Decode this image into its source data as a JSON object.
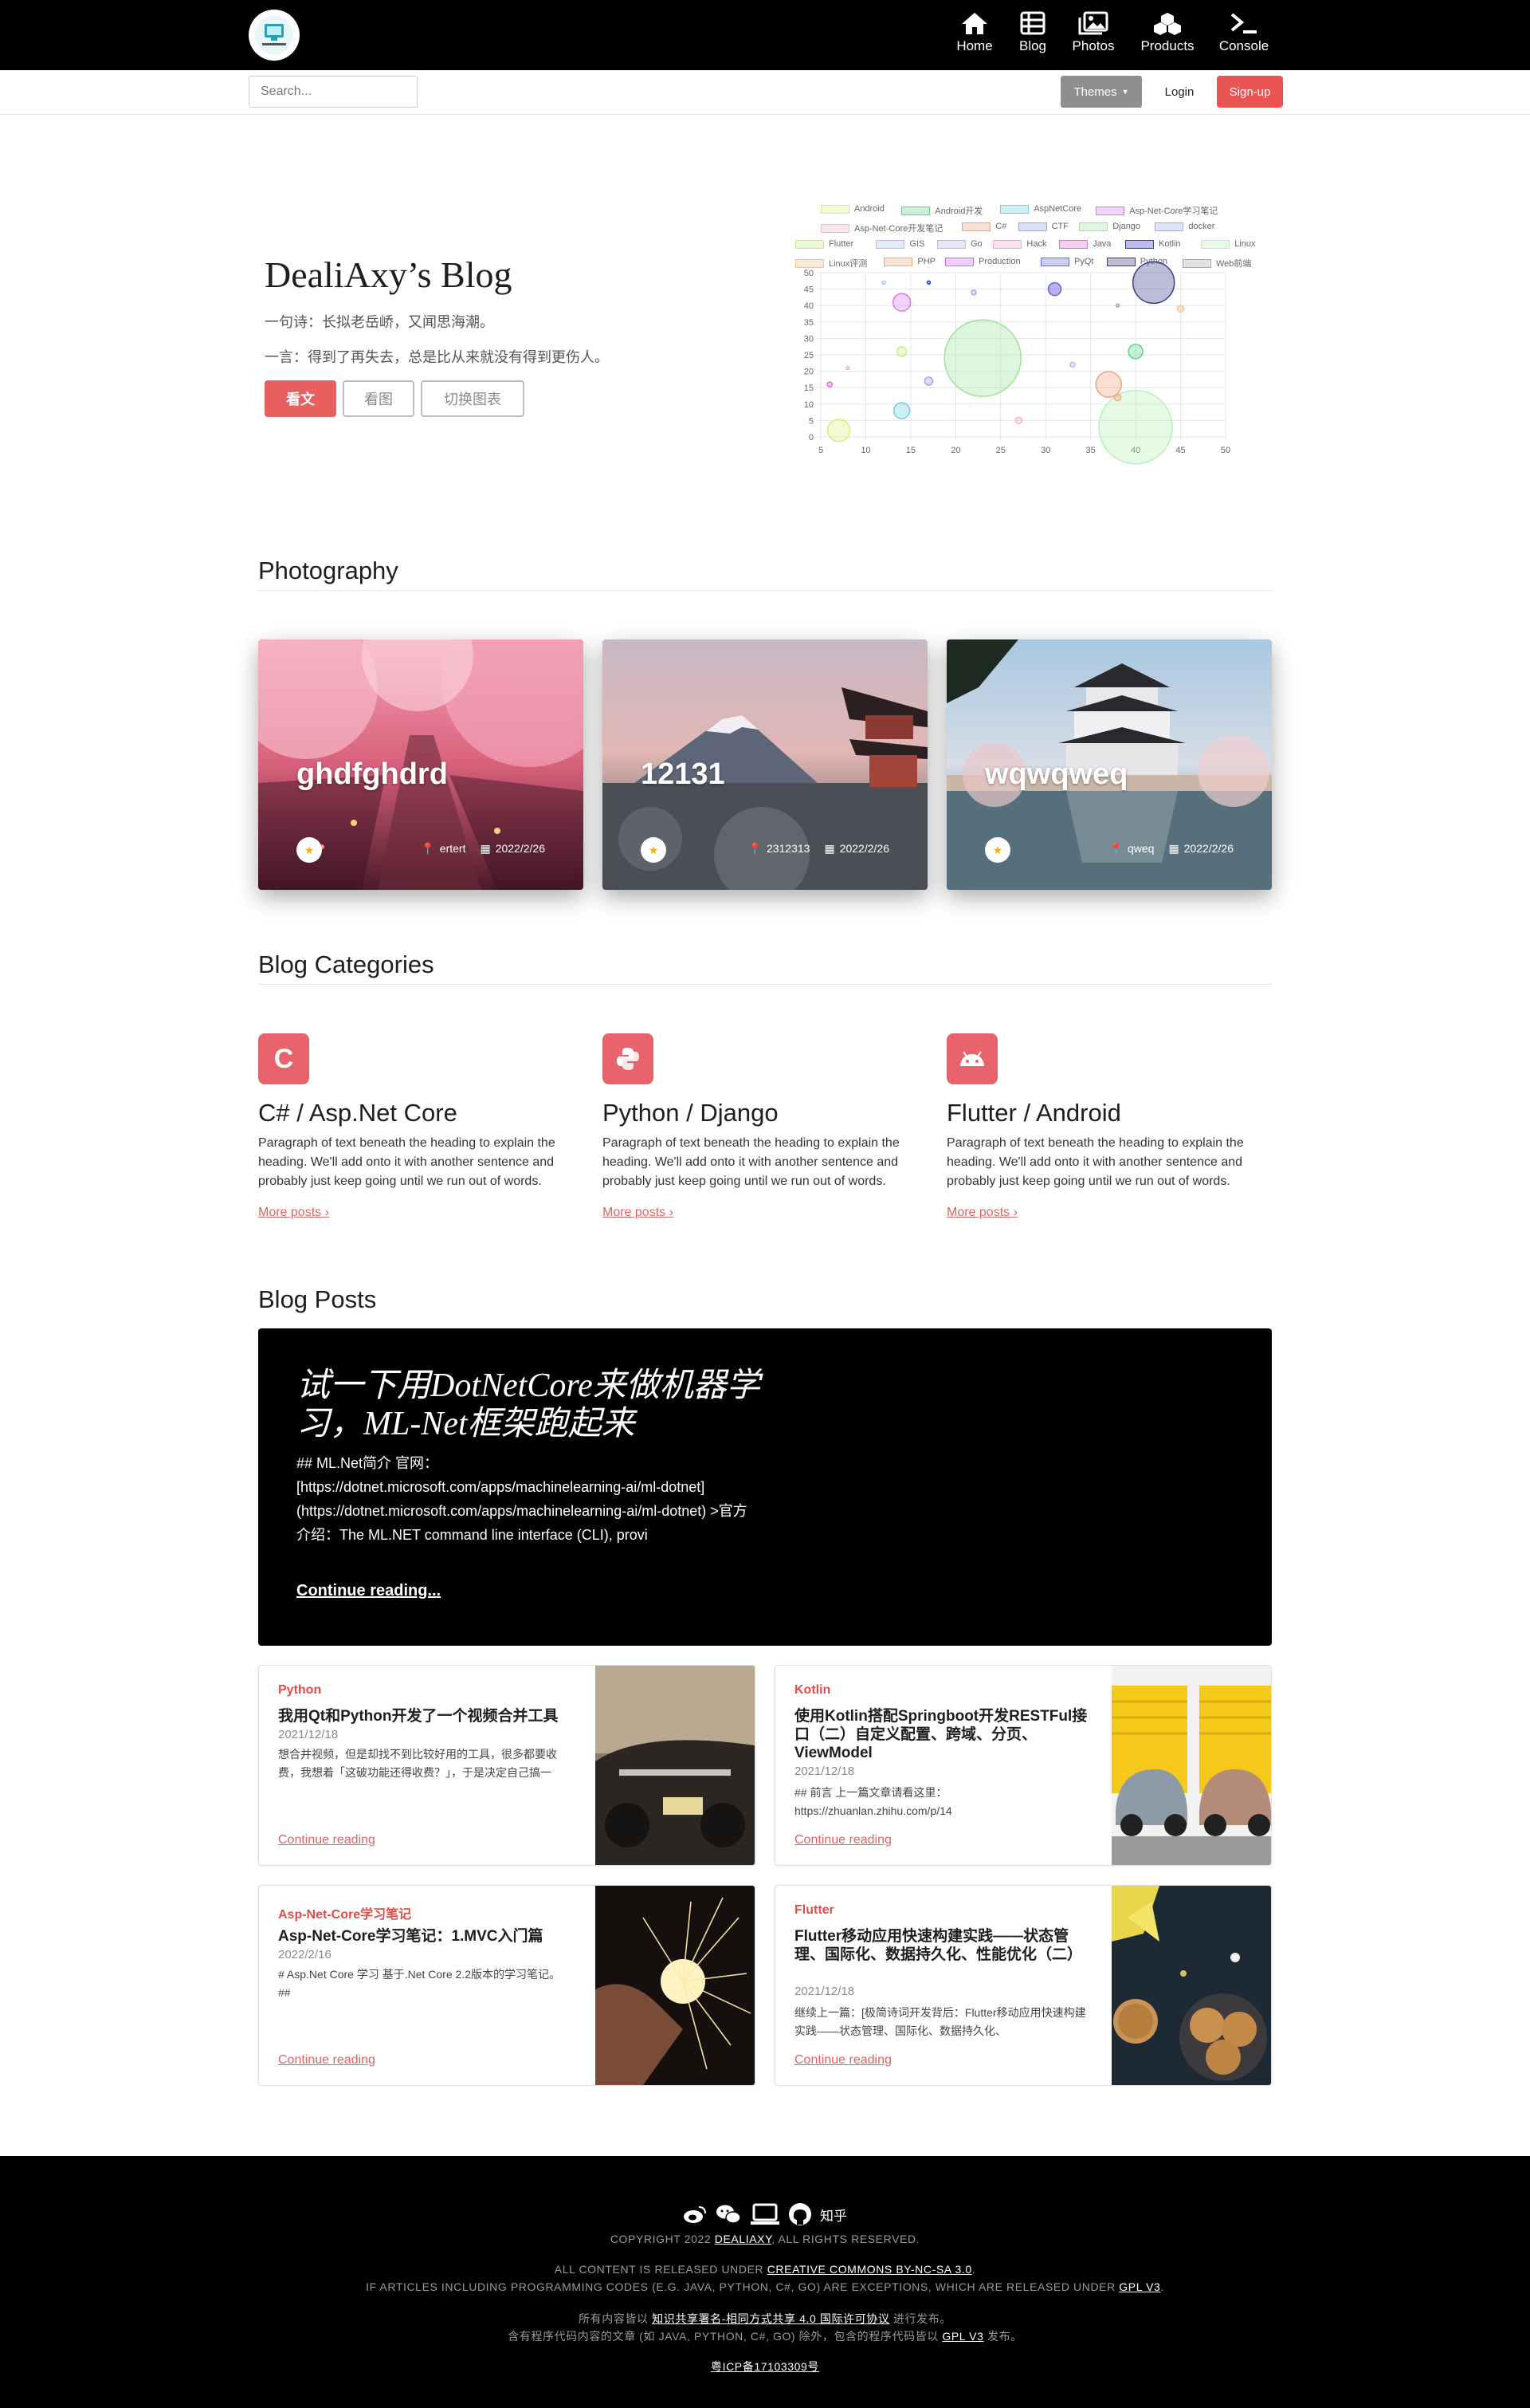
{
  "nav": {
    "items": [
      {
        "label": "Home",
        "icon": "home-icon"
      },
      {
        "label": "Blog",
        "icon": "blog-icon"
      },
      {
        "label": "Photos",
        "icon": "photos-icon"
      },
      {
        "label": "Products",
        "icon": "products-icon"
      },
      {
        "label": "Console",
        "icon": "console-icon"
      }
    ]
  },
  "subbar": {
    "search_placeholder": "Search...",
    "themes_label": "Themes",
    "login_label": "Login",
    "signup_label": "Sign-up"
  },
  "hero": {
    "title": "DealiAxy’s Blog",
    "line1": "一句诗：长拟老岳峤，又闻思海潮。",
    "line2": "一言：得到了再失去，总是比从来就没有得到更伤人。",
    "btn_read": "看文",
    "btn_photo": "看图",
    "btn_switch": "切换图表"
  },
  "chart_data": {
    "type": "scatter",
    "subtype": "bubble",
    "xlim": [
      5,
      50
    ],
    "ylim": [
      0,
      50
    ],
    "xticks": [
      "5",
      "10",
      "15",
      "20",
      "25",
      "30",
      "35",
      "40",
      "45",
      "50"
    ],
    "yticks": [
      "0",
      "5",
      "10",
      "15",
      "20",
      "25",
      "30",
      "35",
      "40",
      "45",
      "50"
    ],
    "legend_position": "top",
    "series": [
      {
        "name": "Android",
        "color": "#d5ef7f",
        "x": 7,
        "y": 2,
        "r": 14
      },
      {
        "name": "Android开发",
        "color": "#5ed486",
        "x": 40,
        "y": 26,
        "r": 9
      },
      {
        "name": "AspNetCore",
        "color": "#6fd0e8",
        "x": 14,
        "y": 8,
        "r": 10
      },
      {
        "name": "Asp-Net-Core学习笔记",
        "color": "#d97af0",
        "x": 14,
        "y": 41,
        "r": 11
      },
      {
        "name": "Asp-Net-Core开发笔记",
        "color": "#f3b6c3",
        "x": 27,
        "y": 5,
        "r": 4
      },
      {
        "name": "C#",
        "color": "#f0a27a",
        "x": 37,
        "y": 16,
        "r": 16
      },
      {
        "name": "CTF",
        "color": "#9aa3f0",
        "x": 17,
        "y": 17,
        "r": 5
      },
      {
        "name": "Django",
        "color": "#a0e39b",
        "x": 23,
        "y": 24,
        "r": 48
      },
      {
        "name": "docker",
        "color": "#9fa7f2",
        "x": 22,
        "y": 44,
        "r": 3
      },
      {
        "name": "Flutter",
        "color": "#c6f07a",
        "x": 14,
        "y": 26,
        "r": 6
      },
      {
        "name": "GIS",
        "color": "#a8c4ee",
        "x": 12,
        "y": 47,
        "r": 2
      },
      {
        "name": "Go",
        "color": "#b5b9f0",
        "x": 33,
        "y": 22,
        "r": 3
      },
      {
        "name": "Hack",
        "color": "#f7a7d4",
        "x": 8,
        "y": 21,
        "r": 2
      },
      {
        "name": "Java",
        "color": "#e86ae0",
        "x": 6,
        "y": 16,
        "r": 3
      },
      {
        "name": "Kotlin",
        "color": "#2f3ad9",
        "x": 17,
        "y": 47,
        "r": 2
      },
      {
        "name": "Linux",
        "color": "#b6f0b5",
        "x": 40,
        "y": 3,
        "r": 46
      },
      {
        "name": "Linux评测",
        "color": "#f6c08a",
        "x": 45,
        "y": 39,
        "r": 4
      },
      {
        "name": "PHP",
        "color": "#f0a878",
        "x": 38,
        "y": 12,
        "r": 4
      },
      {
        "name": "Production",
        "color": "#d36cf2",
        "x": 31,
        "y": 45,
        "r": 8
      },
      {
        "name": "PyQt",
        "color": "#6470d8",
        "x": 31,
        "y": 45,
        "r": 8
      },
      {
        "name": "Python",
        "color": "#3b3a8a",
        "x": 42,
        "y": 47,
        "r": 26
      },
      {
        "name": "Web前端",
        "color": "#a8a8a8",
        "x": 38,
        "y": 40,
        "r": 2
      }
    ]
  },
  "photography": {
    "heading": "Photography",
    "cards": [
      {
        "title": "ghdfghdrd",
        "location": "ertert",
        "date": "2022/2/26"
      },
      {
        "title": "12131",
        "location": "2312313",
        "date": "2022/2/26"
      },
      {
        "title": "wqwqweq",
        "location": "qweq",
        "date": "2022/2/26"
      }
    ]
  },
  "categories": {
    "heading": "Blog Categories",
    "items": [
      {
        "icon_text": "C",
        "title": "C# / Asp.Net Core",
        "text": "Paragraph of text beneath the heading to explain the heading. We'll add onto it with another sentence and probably just keep going until we run out of words.",
        "link": "More posts"
      },
      {
        "icon_text": "",
        "title": "Python / Django",
        "text": "Paragraph of text beneath the heading to explain the heading. We'll add onto it with another sentence and probably just keep going until we run out of words.",
        "link": "More posts"
      },
      {
        "icon_text": "",
        "title": "Flutter / Android",
        "text": "Paragraph of text beneath the heading to explain the heading. We'll add onto it with another sentence and probably just keep going until we run out of words.",
        "link": "More posts"
      }
    ]
  },
  "posts": {
    "heading": "Blog Posts",
    "featured": {
      "title": "试一下用DotNetCore来做机器学习，ML-Net框架跑起来",
      "text": "## ML.Net简介 官网：[https://dotnet.microsoft.com/apps/machinelearning-ai/ml-dotnet](https://dotnet.microsoft.com/apps/machinelearning-ai/ml-dotnet) >官方介绍：The ML.NET command line interface (CLI), provi",
      "link": "Continue reading..."
    },
    "items": [
      {
        "tag": "Python",
        "title": "我用Qt和Python开发了一个视频合并工具",
        "date": "2021/12/18",
        "body": "想合并视频，但是却找不到比较好用的工具，很多都要收费，我想着「这破功能还得收费？」，于是决定自己搞一",
        "link": "Continue reading"
      },
      {
        "tag": "Kotlin",
        "title": "使用Kotlin搭配Springboot开发RESTFul接口（二）自定义配置、跨域、分页、ViewModel",
        "date": "2021/12/18",
        "body": "## 前言 上一篇文章请看这里：https://zhuanlan.zhihu.com/p/14",
        "link": "Continue reading"
      },
      {
        "tag": "Asp-Net-Core学习笔记",
        "title": "Asp-Net-Core学习笔记：1.MVC入门篇",
        "date": "2022/2/16",
        "body": "# Asp.Net Core 学习 基于.Net Core 2.2版本的学习笔记。 ##",
        "link": "Continue reading"
      },
      {
        "tag": "Flutter",
        "title": "Flutter移动应用快速构建实践——状态管理、国际化、数据持久化、性能优化（二）",
        "date": "2021/12/18",
        "body": "继续上一篇：[极简诗词开发背后：Flutter移动应用快速构建实践——状态管理、国际化、数据持久化、",
        "link": "Continue reading"
      }
    ]
  },
  "footer": {
    "zhihu": "知乎",
    "copyright_pre": "COPYRIGHT 2022 ",
    "copyright_link": "DEALIAXY",
    "copyright_post": ", ALL RIGHTS RESERVED.",
    "license1_pre": "ALL CONTENT IS RELEASED UNDER ",
    "license1_link": "CREATIVE COMMONS BY-NC-SA 3.0",
    "license1_post": ".",
    "license2_pre": "IF ARTICLES INCLUDING PROGRAMMING CODES (E.G. JAVA, PYTHON, C#, GO) ARE EXCEPTIONS, WHICH ARE RELEASED UNDER ",
    "license2_link": "GPL V3",
    "license2_post": ".",
    "cn1_pre": "所有内容皆以 ",
    "cn1_link": "知识共享署名-相同方式共享 4.0 国际许可协议",
    "cn1_post": " 进行发布。",
    "cn2_pre": "含有程序代码内容的文章 (如 JAVA, PYTHON, C#, GO) 除外，包含的程序代码皆以 ",
    "cn2_link": "GPL V3",
    "cn2_post": " 发布。",
    "icp": "粤ICP备17103309号"
  }
}
